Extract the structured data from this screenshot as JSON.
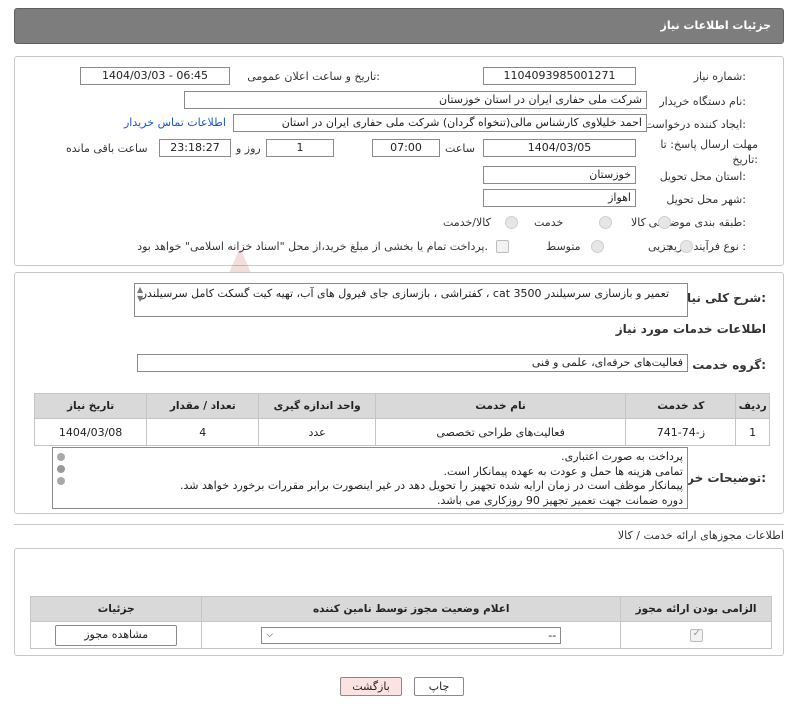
{
  "header": {
    "title": "جزئیات اطلاعات نیاز"
  },
  "form": {
    "need_number": {
      "label": "شماره نیاز:",
      "value": "1104093985001271"
    },
    "announce_datetime": {
      "label": "تاریخ و ساعت اعلان عمومی:",
      "value": "1404/03/03 - 06:45"
    },
    "buyer_org": {
      "label": "نام دستگاه خریدار:",
      "value": "شرکت ملی حفاری ایران در استان خوزستان"
    },
    "creator": {
      "label": "ایجاد کننده درخواست:",
      "value": "احمد خلیلاوی کارشناس مالی(تنخواه گردان) شرکت ملی حفاری ایران در استان",
      "contact_link": "اطلاعات تماس خریدار"
    },
    "deadline": {
      "label": "مهلت ارسال پاسخ: تا تاریخ:",
      "date": "1404/03/05",
      "time_label": "ساعت",
      "time": "07:00",
      "days": "1",
      "days_label": "روز و",
      "remaining": "23:18:27",
      "remaining_label": "ساعت باقی مانده"
    },
    "province": {
      "label": "استان محل تحویل:",
      "value": "خوزستان"
    },
    "city": {
      "label": "شهر محل تحویل:",
      "value": "اهواز"
    },
    "category": {
      "label": "طبقه بندی موضوعی:",
      "options": [
        "کالا",
        "خدمت",
        "کالا/خدمت"
      ]
    },
    "purchase_type": {
      "label": "نوع فرآیند خرید :",
      "options": [
        "جزیی",
        "متوسط"
      ],
      "note": "پرداخت تمام یا بخشی از مبلغ خرید،از محل \"اسناد خزانه اسلامی\" خواهد بود."
    }
  },
  "summary": {
    "label": "شرح کلی نیاز:",
    "value": "تعمیر و بازسازی سرسیلندر cat 3500 ، کفتراشی ، بازسازی جای فیرول های آب، تهیه کیت گسکت کامل سرسیلندر"
  },
  "services": {
    "section_title": "اطلاعات خدمات مورد نیاز",
    "group_label": "گروه خدمت:",
    "group_value": "فعالیت‌های حرفه‌ای، علمی و فنی",
    "table": {
      "headers": [
        "ردیف",
        "کد خدمت",
        "نام خدمت",
        "واحد اندازه گیری",
        "تعداد / مقدار",
        "تاریخ نیاز"
      ],
      "rows": [
        [
          "1",
          "ز-74-741",
          "فعالیت‌های طراحی تخصصی",
          "عدد",
          "4",
          "1404/03/08"
        ]
      ]
    }
  },
  "buyer_notes": {
    "label": "توضیحات خریدار:",
    "lines": [
      "پرداخت به صورت اعتباری.",
      "تمامی هزینه ها حمل و عودت به عهده پیمانکار است.",
      "پیمانکار موظف است در زمان ارایه شده تجهیز را تحویل دهد در غیر اینصورت برابر مقررات برخورد خواهد شد.",
      "دوره ضمانت جهت تعمیر تجهیز  90 روزکاری می باشد."
    ]
  },
  "licenses": {
    "section_title": "اطلاعات مجوزهای ارائه خدمت / کالا",
    "headers": [
      "الزامی بودن ارائه مجوز",
      "اعلام وضعیت مجوز توسط نامین کننده",
      "جزئیات"
    ],
    "select_value": "--",
    "view_button": "مشاهده مجوز"
  },
  "footer": {
    "print_label": "چاپ",
    "back_label": "بازگشت"
  },
  "watermark_text": "AriaTender.neT",
  "colors": {
    "header_bg": "#7d7d7d",
    "table_header": "#d9d9d9",
    "link": "#1a56c8",
    "back_button_bg": "#fde2e2"
  }
}
